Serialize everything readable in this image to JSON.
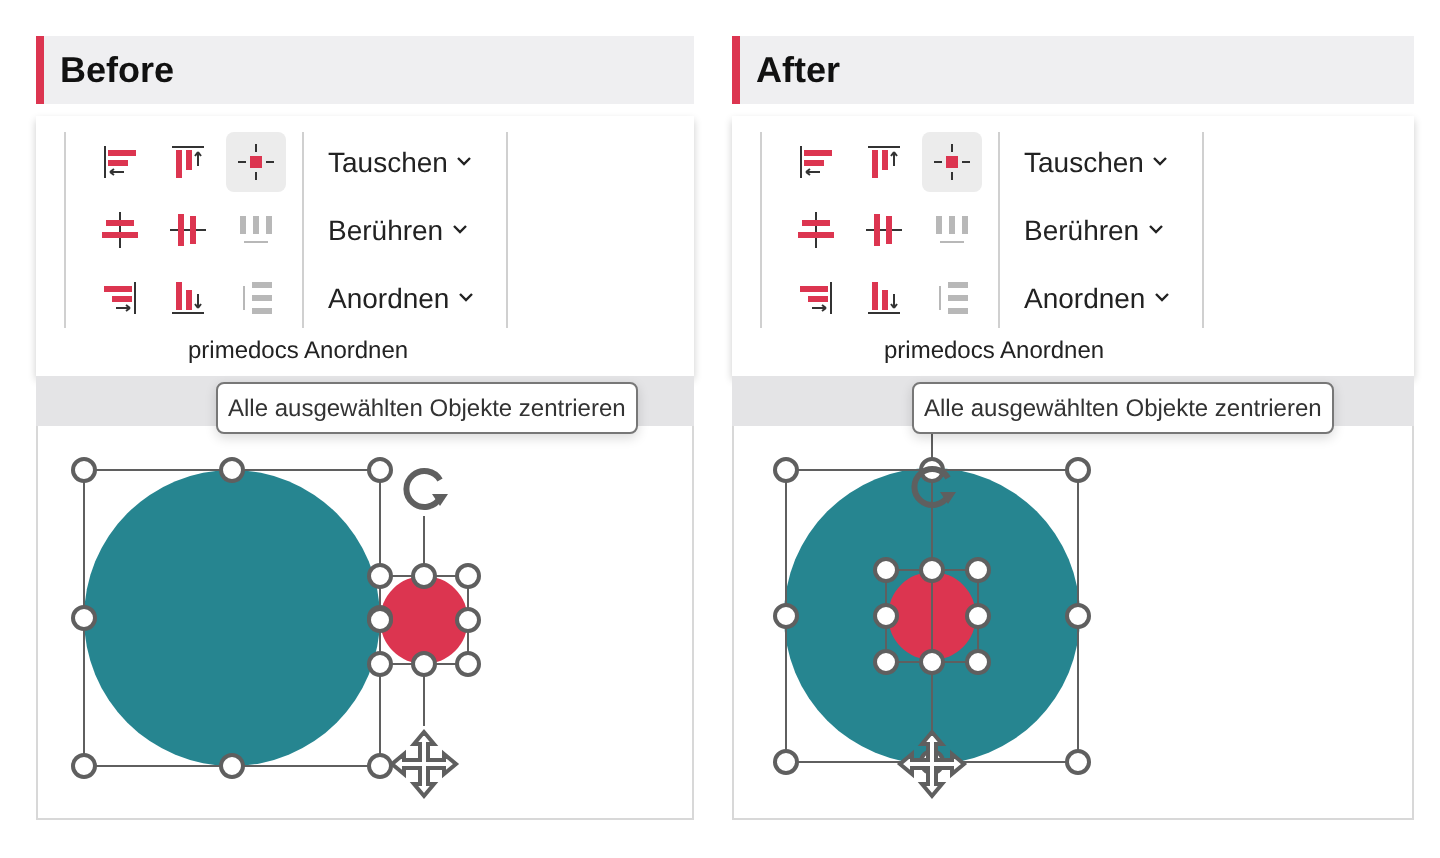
{
  "panels": [
    {
      "title": "Before",
      "ribbon": {
        "buttons": [
          {
            "kind": "align-left",
            "selected": false,
            "disabled": false
          },
          {
            "kind": "align-top",
            "selected": false,
            "disabled": false
          },
          {
            "kind": "center",
            "selected": true,
            "disabled": false
          },
          {
            "kind": "center-h",
            "selected": false,
            "disabled": false
          },
          {
            "kind": "center-v",
            "selected": false,
            "disabled": false
          },
          {
            "kind": "distribute-h",
            "selected": false,
            "disabled": true
          },
          {
            "kind": "align-right",
            "selected": false,
            "disabled": false
          },
          {
            "kind": "align-bottom",
            "selected": false,
            "disabled": false
          },
          {
            "kind": "distribute-v",
            "selected": false,
            "disabled": true
          }
        ],
        "menus": [
          {
            "label": "Tauschen"
          },
          {
            "label": "Berühren"
          },
          {
            "label": "Anordnen"
          }
        ],
        "group_label": "primedocs Anordnen"
      },
      "tooltip": "Alle ausgewählten Objekte zentrieren",
      "canvas": {
        "kind": "apart"
      }
    },
    {
      "title": "After",
      "ribbon": {
        "buttons": [
          {
            "kind": "align-left",
            "selected": false,
            "disabled": false
          },
          {
            "kind": "align-top",
            "selected": false,
            "disabled": false
          },
          {
            "kind": "center",
            "selected": true,
            "disabled": false
          },
          {
            "kind": "center-h",
            "selected": false,
            "disabled": false
          },
          {
            "kind": "center-v",
            "selected": false,
            "disabled": false
          },
          {
            "kind": "distribute-h",
            "selected": false,
            "disabled": true
          },
          {
            "kind": "align-right",
            "selected": false,
            "disabled": false
          },
          {
            "kind": "align-bottom",
            "selected": false,
            "disabled": false
          },
          {
            "kind": "distribute-v",
            "selected": false,
            "disabled": true
          }
        ],
        "menus": [
          {
            "label": "Tauschen"
          },
          {
            "label": "Berühren"
          },
          {
            "label": "Anordnen"
          }
        ],
        "group_label": "primedocs Anordnen"
      },
      "tooltip": "Alle ausgewählten Objekte zentrieren",
      "canvas": {
        "kind": "centered"
      }
    }
  ]
}
